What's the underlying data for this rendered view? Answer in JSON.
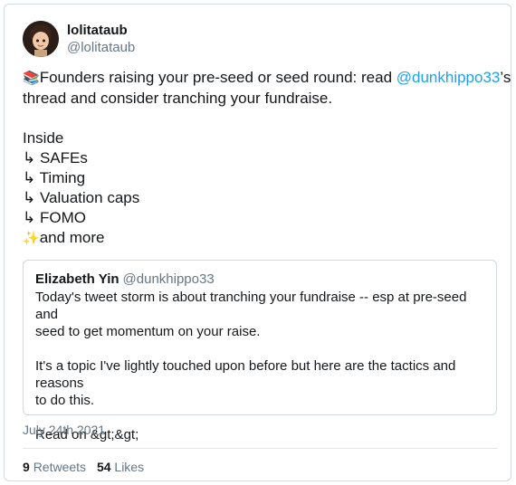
{
  "author": {
    "name": "lolitataub",
    "handle": "@lolitataub",
    "avatar_icon": "memoji-avatar-icon"
  },
  "tweet": {
    "line1_emoji": "📚",
    "line1_text": "Founders raising your pre-seed or seed round: read ",
    "line1_mention": "@dunkhippo33",
    "line1_suffix": "’s",
    "line2": "thread and consider tranching your fundraise.",
    "line3": "",
    "line4": "Inside",
    "line5": "↳ SAFEs",
    "line6": "↳ Timing",
    "line7": "↳ Valuation caps",
    "line8": "↳ FOMO",
    "line9_emoji": "✨",
    "line9_text": "and more"
  },
  "quote": {
    "name": "Elizabeth Yin",
    "handle": "@dunkhippo33",
    "lines": [
      "Today's tweet storm is about tranching your fundraise -- esp at pre-seed and",
      "seed to get momentum on your raise.",
      "",
      "It's a topic I've lightly touched upon before but here are the tactics and reasons",
      "to do this.",
      "",
      "Read on &gt;&gt;"
    ]
  },
  "date": "July 24th 2021",
  "stats": {
    "retweets_count": "9",
    "retweets_label": "Retweets",
    "likes_count": "54",
    "likes_label": "Likes"
  }
}
